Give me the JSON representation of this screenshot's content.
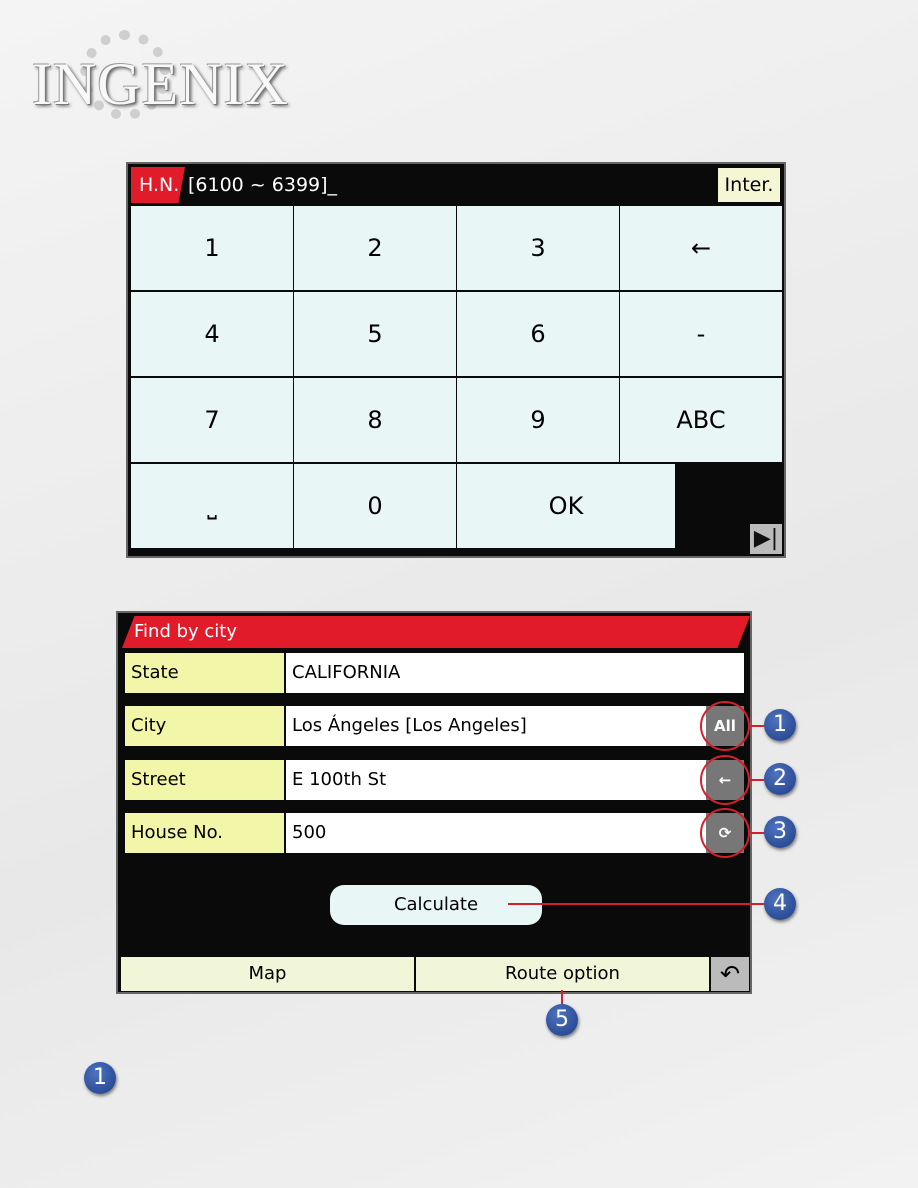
{
  "logo": "INGENIX",
  "keypad": {
    "mode_label": "H.N.",
    "input_value": "[6100 ~ 6399]_",
    "inter_label": "Inter.",
    "keys": [
      "1",
      "2",
      "3",
      "←",
      "4",
      "5",
      "6",
      "-",
      "7",
      "8",
      "9",
      "ABC",
      "⎵",
      "0",
      "OK"
    ],
    "skip_icon": "skip-forward-icon"
  },
  "form": {
    "title": "Find by city",
    "rows": [
      {
        "label": "State",
        "value": "CALIFORNIA"
      },
      {
        "label": "City",
        "value": "Los Ángeles [Los Angeles]",
        "button": "All"
      },
      {
        "label": "Street",
        "value": "E 100th St",
        "button": "←"
      },
      {
        "label": "House No.",
        "value": "500",
        "button": "⟳"
      }
    ],
    "calculate": "Calculate",
    "map": "Map",
    "route_option": "Route option",
    "back_icon": "undo-icon"
  },
  "callouts": [
    "1",
    "2",
    "3",
    "4",
    "5",
    "1"
  ],
  "accent": "#e21b2b"
}
